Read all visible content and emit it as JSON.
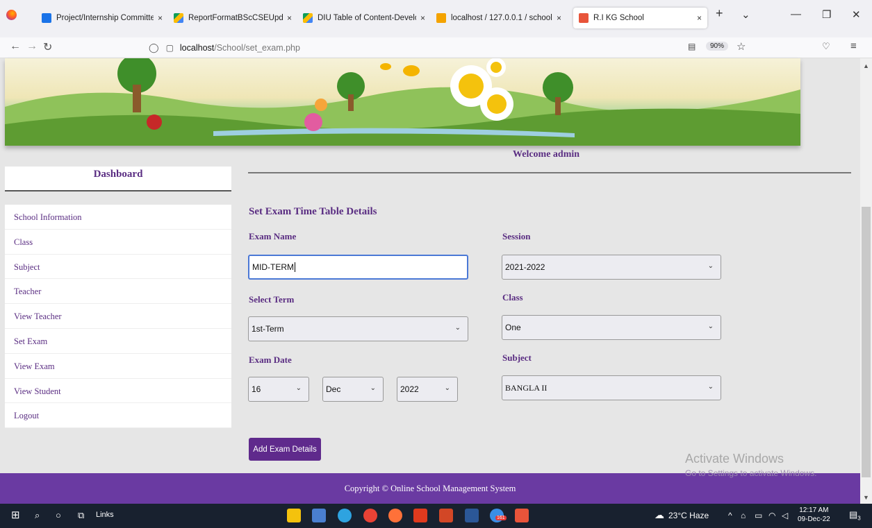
{
  "browser": {
    "tabs": [
      {
        "title": "Project/Internship Committe",
        "close": "×",
        "color": "#1a73e8"
      },
      {
        "title": "ReportFormatBScCSEUpdated",
        "close": "×",
        "color": "#fbbc04"
      },
      {
        "title": "DIU Table of Content-Develop",
        "close": "×",
        "color": "#fbbc04"
      },
      {
        "title": "localhost / 127.0.0.1 / school",
        "close": "×",
        "color": "#f4a300"
      },
      {
        "title": "R.I KG School",
        "close": "×",
        "color": "#e8543a"
      }
    ],
    "new_tab": "+",
    "tab_list": "⌄",
    "minimize": "—",
    "restore": "❐",
    "close": "✕",
    "url_host": "localhost",
    "url_path": "/School/set_exam.php",
    "zoom": "90%"
  },
  "page": {
    "welcome": "Welcome admin",
    "sidebar_title": "Dashboard",
    "menu": [
      "School Information",
      "Class",
      "Subject",
      "Teacher",
      "View Teacher",
      "Set Exam",
      "View Exam",
      "View Student",
      "Logout"
    ],
    "form_title": "Set Exam Time Table Details",
    "labels": {
      "exam_name": "Exam Name",
      "session": "Session",
      "select_term": "Select Term",
      "class": "Class",
      "exam_date": "Exam Date",
      "subject": "Subject"
    },
    "values": {
      "exam_name": "MID-TERM",
      "session": "2021-2022",
      "term": "1st-Term",
      "class": "One",
      "day": "16",
      "month": "Dec",
      "year": "2022",
      "subject": "BANGLA II"
    },
    "submit": "Add Exam Details",
    "footer": "Copyright © Online School Management System"
  },
  "watermark": {
    "line1": "Activate Windows",
    "line2": "Go to Settings to activate Windows."
  },
  "taskbar": {
    "links": "Links",
    "weather": "23°C  Haze",
    "time": "12:17 AM",
    "date": "09-Dec-22",
    "notif_count": "3",
    "badge": "161"
  }
}
